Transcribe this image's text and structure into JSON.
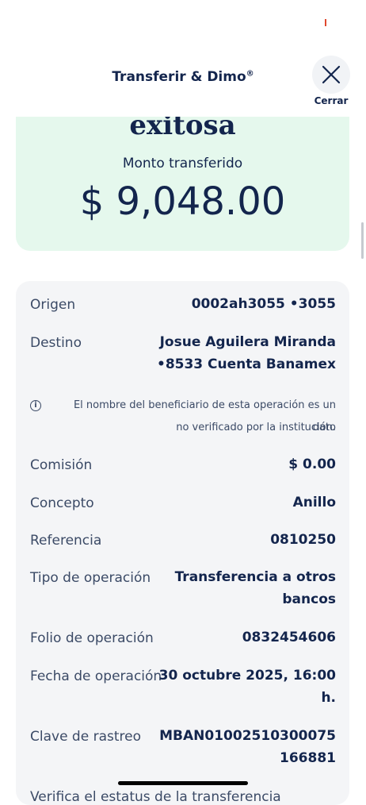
{
  "header": {
    "title": "Transferir & Dimo",
    "title_mark": "®",
    "close_label": "Cerrar"
  },
  "success": {
    "title": "exitosa",
    "subtitle": "Monto transferido",
    "amount": "$ 9,048.00"
  },
  "details": {
    "origen": {
      "label": "Origen",
      "value": "0002ah3055 •3055"
    },
    "destino": {
      "label": "Destino",
      "value_line1": "Josue Aguilera Miranda",
      "value_line2": "•8533 Cuenta Banamex"
    },
    "note": {
      "line1": "El nombre del beneficiario de esta operación es un dato",
      "line2": "no verificado por la institución."
    },
    "comision": {
      "label": "Comisión",
      "value": "$ 0.00"
    },
    "concepto": {
      "label": "Concepto",
      "value": "Anillo"
    },
    "referencia": {
      "label": "Referencia",
      "value": "0810250"
    },
    "tipo": {
      "label": "Tipo de operación",
      "value_line1": "Transferencia a otros",
      "value_line2": "bancos"
    },
    "folio": {
      "label": "Folio de operación",
      "value": "0832454606"
    },
    "fecha": {
      "label": "Fecha de operación",
      "value_line1": "30 octubre 2025, 16:00",
      "value_line2": "h."
    },
    "clave": {
      "label": "Clave de rastreo",
      "value_line1": "MBAN01002510300075",
      "value_line2": "166881"
    },
    "cut_text": "Verifica el estatus de la transferencia"
  },
  "colors": {
    "primary": "#13254d",
    "success_bg": "#e5f8ed",
    "card_bg": "#f4f5f7"
  },
  "icons": {
    "close": "close-icon",
    "info": "info-icon"
  }
}
